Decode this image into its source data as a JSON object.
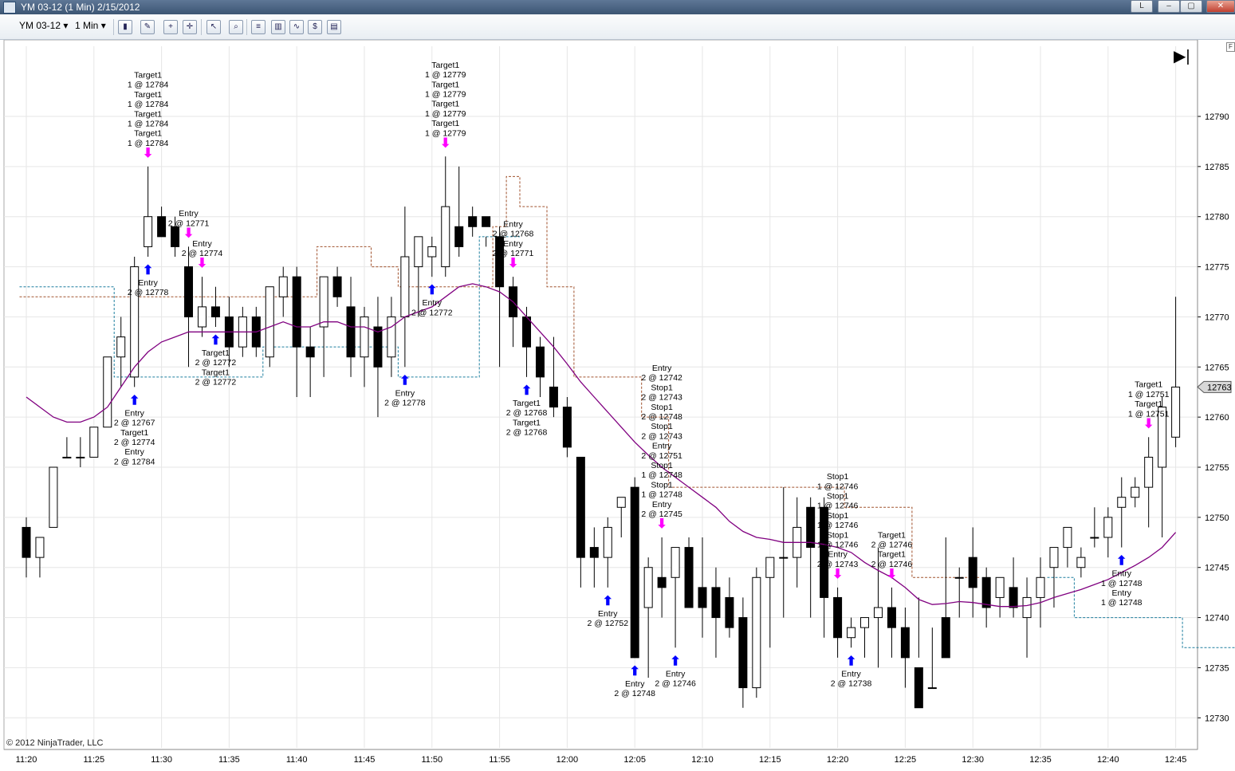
{
  "window": {
    "title": "YM 03-12 (1 Min)  2/15/2012",
    "buttons": [
      "L",
      "–",
      "▢",
      "✕"
    ]
  },
  "toolbar": {
    "instrument": "YM 03-12",
    "interval": "1 Min",
    "icons": [
      "bar-type-icon",
      "drawing-pencil-icon",
      "add-indicator-icon",
      "crosshair-icon",
      "cursor-icon",
      "zoom-icon",
      "strategy-icon",
      "data-series-icon",
      "indicator-icon",
      "price-icon",
      "properties-icon"
    ]
  },
  "footer": {
    "copyright": "© 2012 NinjaTrader, LLC"
  },
  "colors": {
    "candle_up_fill": "#ffffff",
    "candle_down_fill": "#000000",
    "sma_line": "#800080",
    "upper_band": "#a0522d",
    "lower_band": "#1f7f9f",
    "buy_arrow": "#0000ff",
    "sell_arrow": "#ff00ff",
    "last_price_box": "#d8d8d8"
  },
  "chart_data": {
    "type": "candlestick",
    "instrument": "YM 03-12",
    "interval": "1 Min",
    "date": "2/15/2012",
    "x_tick_labels": [
      "11:20",
      "11:25",
      "11:30",
      "11:35",
      "11:40",
      "11:45",
      "11:50",
      "11:55",
      "12:00",
      "12:05",
      "12:10",
      "12:15",
      "12:20",
      "12:25",
      "12:30",
      "12:35",
      "12:40",
      "12:45"
    ],
    "y_tick_labels": [
      "12790",
      "12785",
      "12780",
      "12775",
      "12770",
      "12765",
      "12760",
      "12755",
      "12750",
      "12745",
      "12740",
      "12735",
      "12730"
    ],
    "ylim": [
      12727,
      12797
    ],
    "last_price": "12763",
    "grid": true,
    "candles_start_minute": 0,
    "candles": [
      [
        12749,
        12750,
        12744,
        12746
      ],
      [
        12746,
        12748,
        12744,
        12748
      ],
      [
        12749,
        12755,
        12749,
        12755
      ],
      [
        12756,
        12758,
        12756,
        12756
      ],
      [
        12756,
        12758,
        12755,
        12756
      ],
      [
        12756,
        12759,
        12756,
        12759
      ],
      [
        12759,
        12766,
        12759,
        12766
      ],
      [
        12766,
        12770,
        12763,
        12768
      ],
      [
        12764,
        12776,
        12763,
        12775
      ],
      [
        12777,
        12785,
        12776,
        12780
      ],
      [
        12780,
        12781,
        12778,
        12778
      ],
      [
        12779,
        12780,
        12776,
        12777
      ],
      [
        12775,
        12777,
        12765,
        12770
      ],
      [
        12769,
        12774,
        12768,
        12771
      ],
      [
        12771,
        12773,
        12769,
        12770
      ],
      [
        12770,
        12772,
        12765,
        12767
      ],
      [
        12767,
        12771,
        12766,
        12770
      ],
      [
        12770,
        12771,
        12766,
        12767
      ],
      [
        12766,
        12773,
        12765,
        12773
      ],
      [
        12772,
        12775,
        12770,
        12774
      ],
      [
        12774,
        12775,
        12762,
        12767
      ],
      [
        12767,
        12769,
        12762,
        12766
      ],
      [
        12769,
        12774,
        12764,
        12774
      ],
      [
        12774,
        12775,
        12771,
        12772
      ],
      [
        12771,
        12774,
        12764,
        12766
      ],
      [
        12766,
        12771,
        12763,
        12770
      ],
      [
        12769,
        12772,
        12760,
        12765
      ],
      [
        12766,
        12772,
        12764,
        12770
      ],
      [
        12770,
        12781,
        12765,
        12776
      ],
      [
        12775,
        12778,
        12770,
        12778
      ],
      [
        12776,
        12778,
        12774,
        12777
      ],
      [
        12775,
        12786,
        12774,
        12781
      ],
      [
        12779,
        12785,
        12776,
        12777
      ],
      [
        12780,
        12781,
        12778,
        12779
      ],
      [
        12780,
        12778,
        12777,
        12779
      ],
      [
        12778,
        12779,
        12765,
        12773
      ],
      [
        12773,
        12774,
        12767,
        12770
      ],
      [
        12770,
        12771,
        12764,
        12767
      ],
      [
        12767,
        12768,
        12762,
        12764
      ],
      [
        12763,
        12768,
        12760,
        12761
      ],
      [
        12761,
        12762,
        12756,
        12757
      ],
      [
        12756,
        12756,
        12743,
        12746
      ],
      [
        12747,
        12749,
        12743,
        12746
      ],
      [
        12746,
        12750,
        12743,
        12749
      ],
      [
        12751,
        12752,
        12748,
        12752
      ],
      [
        12753,
        12754,
        12736,
        12736
      ],
      [
        12741,
        12746,
        12734,
        12745
      ],
      [
        12744,
        12748,
        12740,
        12743
      ],
      [
        12744,
        12746,
        12737,
        12747
      ],
      [
        12747,
        12748,
        12741,
        12741
      ],
      [
        12743,
        12748,
        12738,
        12741
      ],
      [
        12743,
        12745,
        12736,
        12740
      ],
      [
        12742,
        12744,
        12738,
        12739
      ],
      [
        12740,
        12742,
        12731,
        12733
      ],
      [
        12733,
        12745,
        12732,
        12744
      ],
      [
        12744,
        12746,
        12737,
        12746
      ],
      [
        12746,
        12753,
        12740,
        12746
      ],
      [
        12746,
        12752,
        12743,
        12749
      ],
      [
        12751,
        12752,
        12740,
        12747
      ],
      [
        12751,
        12752,
        12738,
        12742
      ],
      [
        12742,
        12743,
        12736,
        12738
      ],
      [
        12738,
        12740,
        12737,
        12739
      ],
      [
        12739,
        12740,
        12736,
        12740
      ],
      [
        12740,
        12747,
        12735,
        12741
      ],
      [
        12741,
        12743,
        12736,
        12739
      ],
      [
        12739,
        12741,
        12733,
        12736
      ],
      [
        12735,
        12742,
        12736,
        12731
      ],
      [
        12733,
        12739,
        12733,
        12733
      ],
      [
        12740,
        12748,
        12736,
        12736
      ],
      [
        12744,
        12745,
        12740,
        12744
      ],
      [
        12746,
        12749,
        12740,
        12743
      ],
      [
        12744,
        12745,
        12739,
        12741
      ],
      [
        12742,
        12744,
        12740,
        12744
      ],
      [
        12743,
        12746,
        12740,
        12741
      ],
      [
        12740,
        12744,
        12736,
        12742
      ],
      [
        12742,
        12746,
        12739,
        12744
      ],
      [
        12745,
        12747,
        12741,
        12747
      ],
      [
        12747,
        12749,
        12745,
        12749
      ],
      [
        12745,
        12747,
        12744,
        12746
      ],
      [
        12748,
        12751,
        12747,
        12748
      ],
      [
        12748,
        12751,
        12746,
        12750
      ],
      [
        12751,
        12754,
        12747,
        12752
      ],
      [
        12752,
        12754,
        12751,
        12753
      ],
      [
        12753,
        12758,
        12749,
        12756
      ],
      [
        12755,
        12762,
        12748,
        12761
      ],
      [
        12758,
        12772,
        12757,
        12763
      ]
    ],
    "annotations": [
      {
        "minute": 9,
        "side": "above",
        "lines": [
          "Target1",
          "1 @ 12784",
          "Target1",
          "1 @ 12784",
          "Target1",
          "1 @ 12784",
          "Target1",
          "1 @ 12784"
        ],
        "arrow": "down"
      },
      {
        "minute": 12,
        "side": "above",
        "lines": [
          "Entry",
          "2 @ 12771"
        ],
        "arrow": "down"
      },
      {
        "minute": 13,
        "side": "above",
        "lines": [
          "Entry",
          "2 @ 12774"
        ],
        "arrow": "down"
      },
      {
        "minute": 9,
        "side": "below",
        "lines": [
          "Entry",
          "2 @ 12778"
        ],
        "arrow": "up"
      },
      {
        "minute": 14,
        "side": "below",
        "lines": [
          "Target1",
          "2 @ 12772",
          "Target1",
          "2 @ 12772"
        ],
        "arrow": "up"
      },
      {
        "minute": 8,
        "side": "below",
        "lines": [
          "Entry",
          "2 @ 12767",
          "Target1",
          "2 @ 12774",
          "Entry",
          "2 @ 12784"
        ],
        "arrow": "up"
      },
      {
        "minute": 31,
        "side": "above",
        "lines": [
          "Target1",
          "1 @ 12779",
          "Target1",
          "1 @ 12779",
          "Target1",
          "1 @ 12779",
          "Target1",
          "1 @ 12779"
        ],
        "arrow": "down"
      },
      {
        "minute": 30,
        "side": "below",
        "lines": [
          "Entry",
          "2 @ 12772"
        ],
        "arrow": "up"
      },
      {
        "minute": 28,
        "side": "below",
        "lines": [
          "Entry",
          "2 @ 12778"
        ],
        "arrow": "up"
      },
      {
        "minute": 36,
        "side": "above",
        "lines": [
          "Entry",
          "2 @ 12768",
          "Entry",
          "2 @ 12771"
        ],
        "arrow": "down"
      },
      {
        "minute": 37,
        "side": "below",
        "lines": [
          "Target1",
          "2 @ 12768",
          "Target1",
          "2 @ 12768"
        ],
        "arrow": "up"
      },
      {
        "minute": 43,
        "side": "below",
        "lines": [
          "Entry",
          "2 @ 12752"
        ],
        "arrow": "up"
      },
      {
        "minute": 45,
        "side": "below",
        "lines": [
          "Entry",
          "2 @ 12748"
        ],
        "arrow": "up"
      },
      {
        "minute": 47,
        "side": "above",
        "lines": [
          "Entry",
          "2 @ 12742",
          "Stop1",
          "2 @ 12743",
          "Stop1",
          "2 @ 12748",
          "Stop1",
          "2 @ 12743",
          "Entry",
          "2 @ 12751",
          "Stop1",
          "1 @ 12748",
          "Stop1",
          "1 @ 12748",
          "Entry",
          "2 @ 12745"
        ],
        "arrow": "down"
      },
      {
        "minute": 48,
        "side": "below",
        "lines": [
          "Entry",
          "2 @ 12746"
        ],
        "arrow": "up"
      },
      {
        "minute": 60,
        "side": "above",
        "lines": [
          "Stop1",
          "1 @ 12746",
          "Stop1",
          "1 @ 12746",
          "Stop1",
          "1 @ 12746",
          "Stop1",
          "1 @ 12746",
          "Entry",
          "2 @ 12743"
        ],
        "arrow": "down"
      },
      {
        "minute": 61,
        "side": "below",
        "lines": [
          "Entry",
          "2 @ 12738"
        ],
        "arrow": "up"
      },
      {
        "minute": 64,
        "side": "above",
        "lines": [
          "Target1",
          "2 @ 12746",
          "Target1",
          "2 @ 12746"
        ],
        "arrow": "down"
      },
      {
        "minute": 81,
        "side": "below",
        "lines": [
          "Entry",
          "1 @ 12748",
          "Entry",
          "1 @ 12748"
        ],
        "arrow": "up"
      },
      {
        "minute": 83,
        "side": "above",
        "lines": [
          "Target1",
          "1 @ 12751",
          "Target1",
          "1 @ 12751"
        ],
        "arrow": "down"
      }
    ],
    "sma": [
      12762,
      12761,
      12760,
      12759.5,
      12759.5,
      12760,
      12761,
      12763,
      12765,
      12766.5,
      12767.5,
      12768,
      12768.5,
      12768.5,
      12768.5,
      12768.5,
      12768.5,
      12768.5,
      12769,
      12769.5,
      12769,
      12769,
      12769.5,
      12769.5,
      12769,
      12769,
      12768.5,
      12769,
      12770,
      12770.5,
      12771,
      12772,
      12773,
      12773.3,
      12773,
      12772.5,
      12771.5,
      12770,
      12768.5,
      12767,
      12765.3,
      12763.5,
      12762,
      12760.5,
      12759,
      12757.5,
      12756.2,
      12755,
      12754,
      12753,
      12752,
      12751,
      12749.6,
      12748.6,
      12748,
      12747.8,
      12747.5,
      12747.5,
      12747.5,
      12747.3,
      12747,
      12746.5,
      12745.5,
      12744.7,
      12744,
      12743,
      12741.8,
      12741.3,
      12741.4,
      12741.6,
      12741.5,
      12741.3,
      12741.1,
      12741.1,
      12741.2,
      12741.5,
      12742,
      12742.4,
      12742.8,
      12743.3,
      12743.8,
      12744.5,
      12745.2,
      12746,
      12747,
      12748.5
    ],
    "upper_band": [
      12772,
      12772,
      12772,
      12772,
      12772,
      12772,
      12772,
      12772,
      12772,
      12772,
      12772,
      12772,
      12772,
      12772,
      12772,
      12772,
      12772,
      12772,
      12772,
      12772,
      12772,
      12772,
      12777,
      12777,
      12777,
      12777,
      12775,
      12775,
      12773,
      12773,
      12773,
      12773,
      12773,
      12773,
      12773,
      12779,
      12784,
      12781,
      12781,
      12773,
      12773,
      12764,
      12764,
      12764,
      12764,
      12764,
      12760,
      12760,
      12753,
      12753,
      12753,
      12753,
      12753,
      12753,
      12753,
      12753,
      12753,
      12753,
      12753,
      12753,
      12753,
      12751,
      12751,
      12751,
      12751,
      12751,
      12744,
      12744,
      12744,
      12744,
      12744
    ],
    "lower_band": [
      12773,
      12773,
      12773,
      12773,
      12773,
      12773,
      12773,
      12764,
      12764,
      12764,
      12764,
      12764,
      12764,
      12764,
      12764,
      12764,
      12764,
      12764,
      12767,
      12767,
      12767,
      12767,
      12767,
      12767,
      12767,
      12767,
      12767,
      12767,
      12764,
      12764,
      12764,
      12764,
      12764,
      12764,
      12778,
      12778,
      12778,
      null,
      null,
      null,
      null,
      null,
      null,
      null,
      null,
      null,
      null,
      null,
      null,
      null,
      null,
      null,
      null,
      null,
      null,
      null,
      null,
      null,
      null,
      null,
      null,
      null,
      null,
      null,
      null,
      null,
      null,
      null,
      null,
      null,
      null,
      null,
      null,
      null,
      null,
      null,
      12744,
      12744,
      12740,
      12740,
      12740,
      12740,
      12740,
      12740,
      12740,
      12740,
      12737,
      12737,
      12737,
      12737,
      12737,
      12737,
      12737,
      12737,
      12749,
      12749
    ]
  }
}
